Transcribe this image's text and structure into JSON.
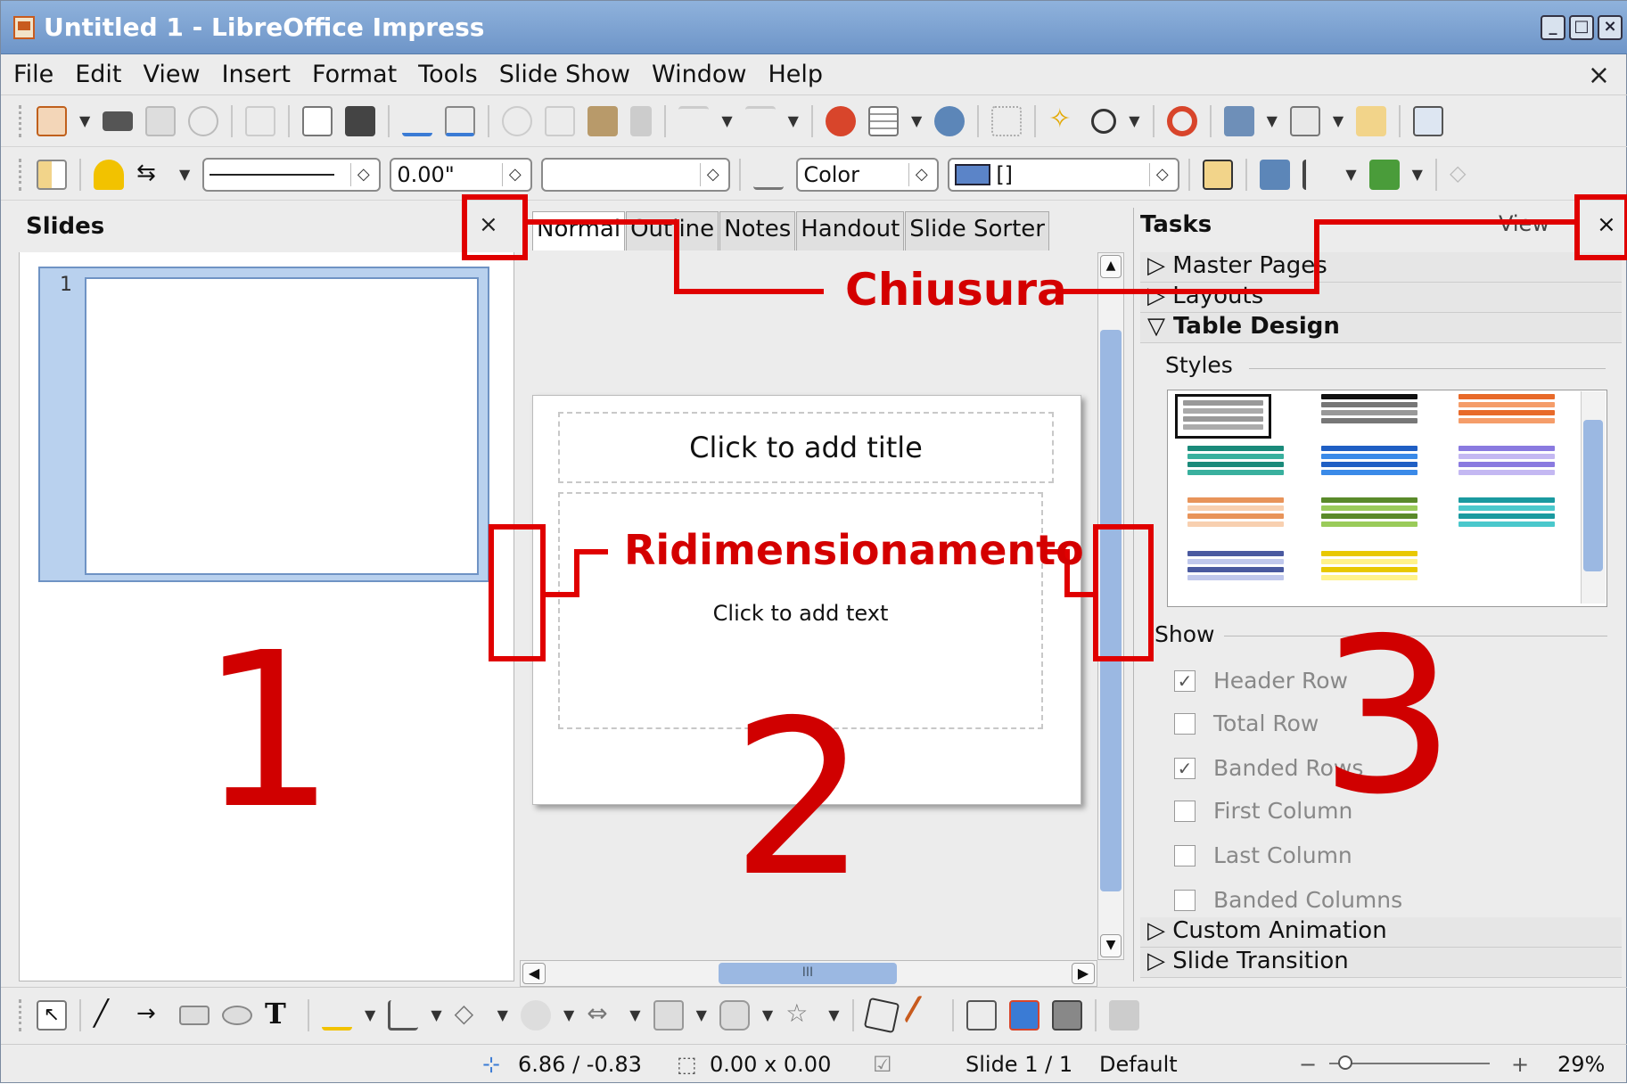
{
  "window": {
    "title": "Untitled 1 - LibreOffice Impress",
    "buttons": [
      "_",
      "□",
      "×"
    ]
  },
  "menu": {
    "items": [
      "File",
      "Edit",
      "View",
      "Insert",
      "Format",
      "Tools",
      "Slide Show",
      "Window",
      "Help"
    ],
    "close": "×"
  },
  "format_bar": {
    "line_width": "0.00\"",
    "fill_type": "Color",
    "color_value": "[]"
  },
  "slides_panel": {
    "title": "Slides",
    "close": "×",
    "slide_number": "1"
  },
  "view_tabs": [
    "Normal",
    "Outline",
    "Notes",
    "Handout",
    "Slide Sorter"
  ],
  "slide": {
    "title_placeholder": "Click to add title",
    "text_placeholder": "Click to add text"
  },
  "hscroll_grip": "III",
  "tasks_panel": {
    "title": "Tasks",
    "view_label": "View",
    "close": "×",
    "sections": {
      "master_pages": "Master Pages",
      "layouts": "Layouts",
      "table_design": "Table Design",
      "custom_animation": "Custom Animation",
      "slide_transition": "Slide Transition"
    },
    "styles_label": "Styles",
    "show_label": "Show",
    "checkboxes": [
      {
        "label": "Header Row",
        "checked": true
      },
      {
        "label": "Total Row",
        "checked": false
      },
      {
        "label": "Banded Rows",
        "checked": true
      },
      {
        "label": "First Column",
        "checked": false
      },
      {
        "label": "Last Column",
        "checked": false
      },
      {
        "label": "Banded Columns",
        "checked": false
      }
    ]
  },
  "status": {
    "position": "6.86 / -0.83",
    "size": "0.00 x 0.00",
    "slide": "Slide 1 / 1",
    "layout": "Default",
    "zoom_minus": "−",
    "zoom_plus": "+",
    "zoom": "29%"
  },
  "annotations": {
    "close_label": "Chiusura",
    "resize_label": "Ridimensionamento",
    "area1": "1",
    "area2": "2",
    "area3": "3",
    "color": "#d40000"
  }
}
